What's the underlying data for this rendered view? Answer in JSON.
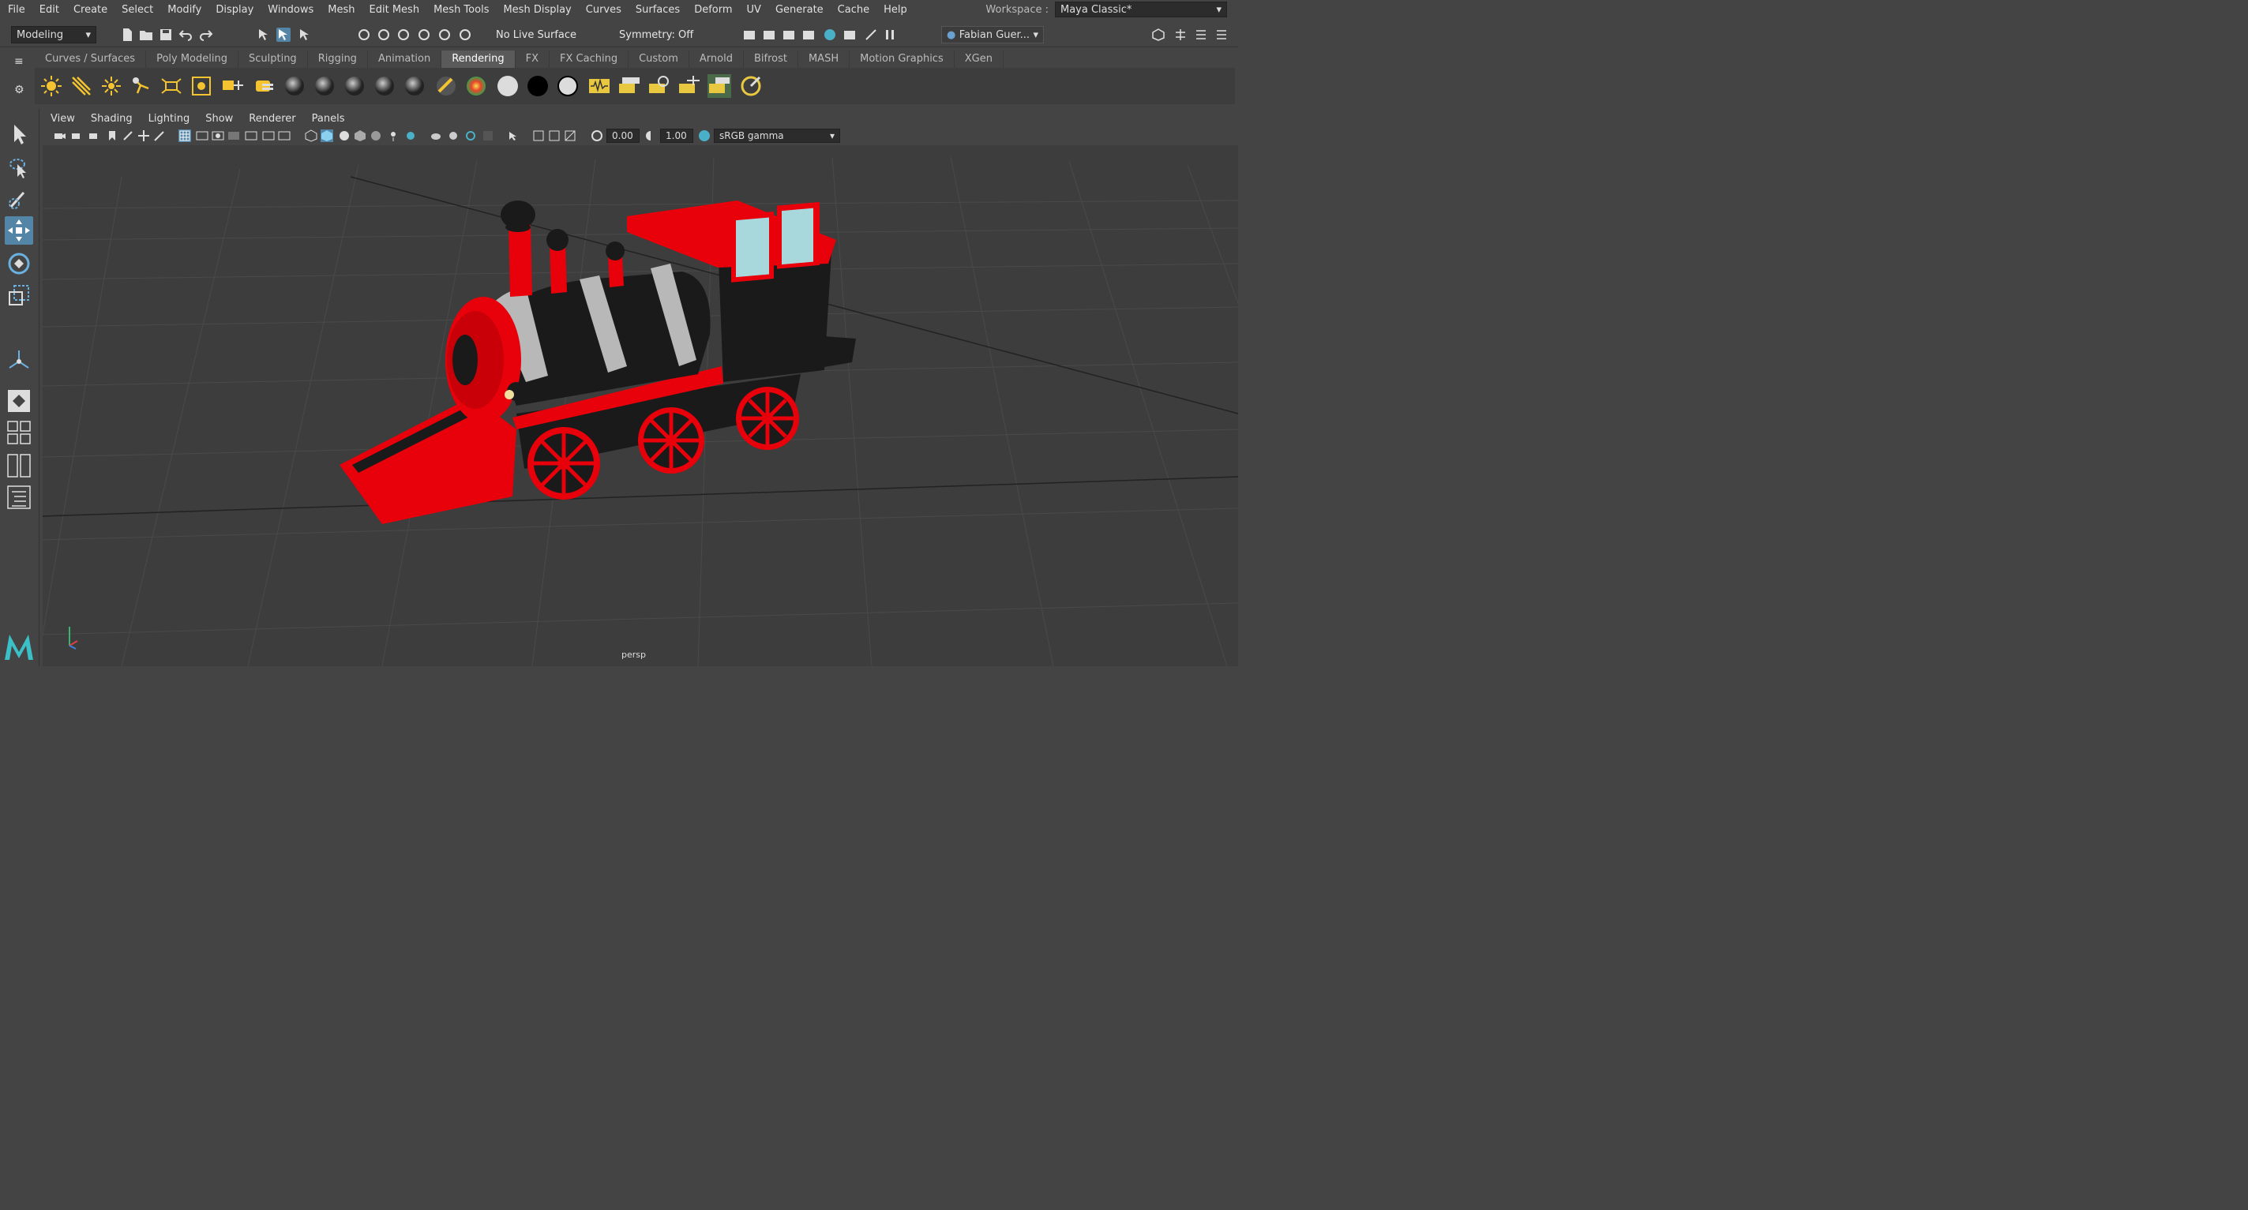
{
  "menubar": {
    "items": [
      "File",
      "Edit",
      "Create",
      "Select",
      "Modify",
      "Display",
      "Windows",
      "Mesh",
      "Edit Mesh",
      "Mesh Tools",
      "Mesh Display",
      "Curves",
      "Surfaces",
      "Deform",
      "UV",
      "Generate",
      "Cache",
      "Help"
    ]
  },
  "workspace": {
    "label": "Workspace :",
    "value": "Maya Classic*"
  },
  "statusline": {
    "menuset": "Modeling",
    "live_surface": "No Live Surface",
    "symmetry": "Symmetry: Off",
    "user": "Fabian Guer..."
  },
  "shelf": {
    "tabs": [
      "Curves / Surfaces",
      "Poly Modeling",
      "Sculpting",
      "Rigging",
      "Animation",
      "Rendering",
      "FX",
      "FX Caching",
      "Custom",
      "Arnold",
      "Bifrost",
      "MASH",
      "Motion Graphics",
      "XGen"
    ],
    "active_tab": "Rendering"
  },
  "panel": {
    "menus": [
      "View",
      "Shading",
      "Lighting",
      "Show",
      "Renderer",
      "Panels"
    ],
    "exposure": "0.00",
    "gamma": "1.00",
    "colorspace": "sRGB gamma",
    "camera": "persp"
  },
  "colors": {
    "accent": "#5285a6",
    "train_red": "#e8000a",
    "train_black": "#1a1a1a"
  }
}
